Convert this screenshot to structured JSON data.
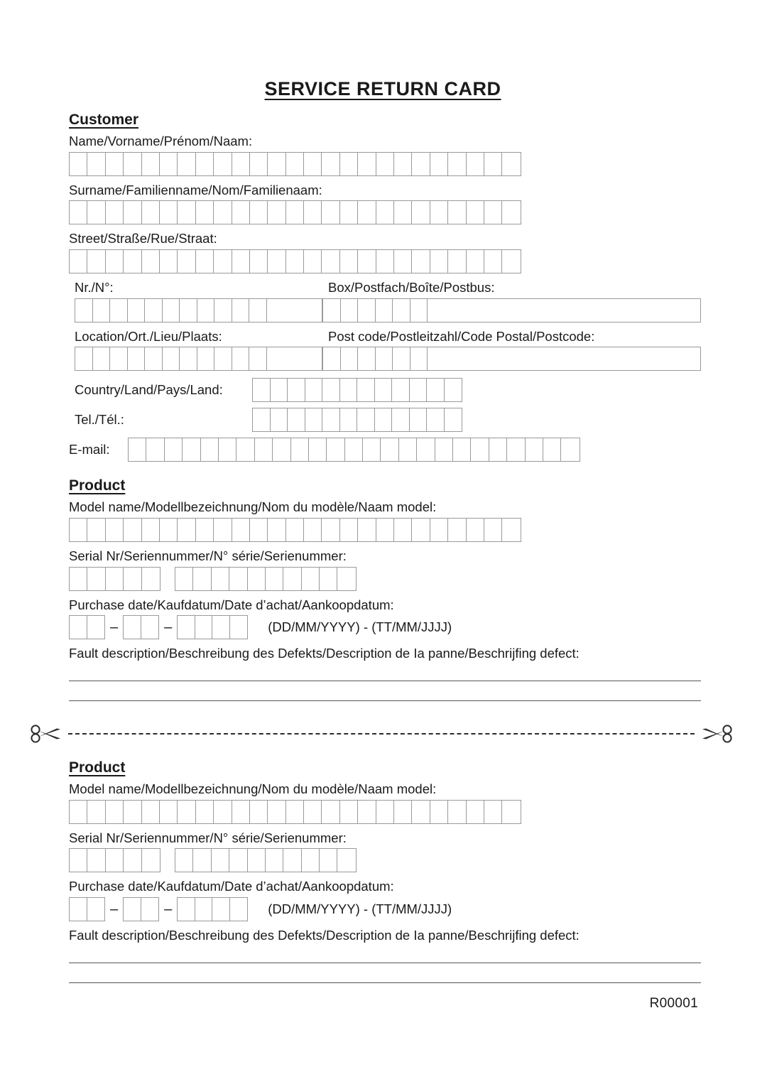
{
  "document": {
    "title": "SERVICE RETURN CARD",
    "footer_code": "R00001"
  },
  "customer": {
    "heading": "Customer",
    "fields": {
      "name": {
        "label": "Name/Vorname/Prénom/Naam:",
        "cells": 25
      },
      "surname": {
        "label": "Surname/Familienname/Nom/Familienaam:",
        "cells": 25
      },
      "street": {
        "label": "Street/Straße/Rue/Straat:",
        "cells": 25
      },
      "number": {
        "label": "Nr./N°:",
        "cells": 12
      },
      "box": {
        "label": "Box/Postfach/Boîte/Postbus:",
        "cells": 7
      },
      "location": {
        "label": "Location/Ort./Lieu/Plaats:",
        "cells": 12
      },
      "postcode": {
        "label": "Post code/Postleitzahl/Code Postal/Postcode:",
        "cells": 7
      },
      "country": {
        "label": "Country/Land/Pays/Land:",
        "cells": 12
      },
      "tel": {
        "label": "Tel./Tél.:",
        "cells": 12
      },
      "email": {
        "label": "E-mail:",
        "cells": 25
      }
    }
  },
  "product_top": {
    "heading": "Product",
    "fields": {
      "model": {
        "label": "Model name/Modellbezeichnung/Nom du modèle/Naam model:",
        "cells": 25
      },
      "serial": {
        "label": "Serial Nr/Seriennummer/N° série/Serienummer:",
        "cells_group1": 5,
        "cells_group2": 10
      },
      "purchase_date": {
        "label": "Purchase date/Kaufdatum/Date d’achat/Aankoopdatum:",
        "day_cells": 2,
        "month_cells": 2,
        "year_cells": 4,
        "separator": "–",
        "format_note": "(DD/MM/YYYY) - (TT/MM/JJJJ)"
      },
      "fault": {
        "label": "Fault description/Beschreibung des Defekts/Description de Ia panne/Beschrijfing defect:",
        "lines": 2
      }
    }
  },
  "cut_line": {
    "left_icon": "scissors-icon",
    "right_icon": "scissors-icon"
  },
  "product_bottom": {
    "heading": "Product",
    "fields": {
      "model": {
        "label": "Model name/Modellbezeichnung/Nom du modèle/Naam model:",
        "cells": 25
      },
      "serial": {
        "label": "Serial Nr/Seriennummer/N° série/Serienummer:",
        "cells_group1": 5,
        "cells_group2": 10
      },
      "purchase_date": {
        "label": "Purchase date/Kaufdatum/Date d’achat/Aankoopdatum:",
        "day_cells": 2,
        "month_cells": 2,
        "year_cells": 4,
        "separator": "–",
        "format_note": "(DD/MM/YYYY) - (TT/MM/JJJJ)"
      },
      "fault": {
        "label": "Fault description/Beschreibung des Defekts/Description de Ia panne/Beschrijfing defect:",
        "lines": 2
      }
    }
  },
  "colors": {
    "text": "#1a1a1a",
    "box_border": "#9a9a9a",
    "rule": "#555555",
    "background": "#ffffff"
  }
}
